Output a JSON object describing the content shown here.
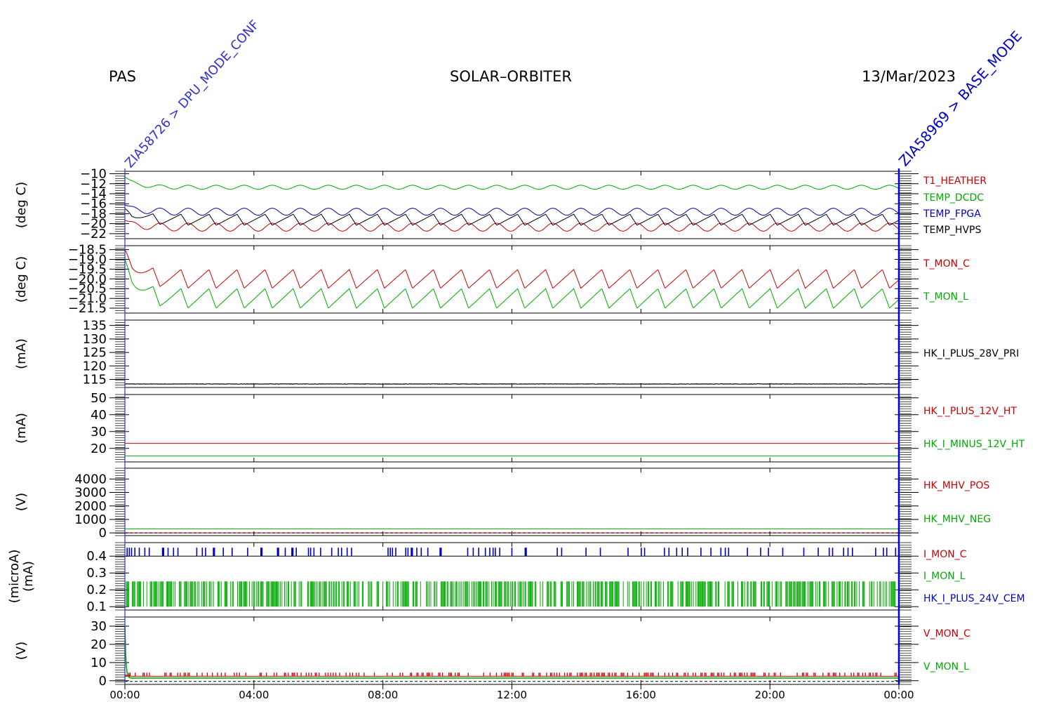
{
  "header": {
    "instrument": "PAS",
    "mission": "SOLAR–ORBITER",
    "date": "13/Mar/2023"
  },
  "event_markers": {
    "left": {
      "label": "ZIA58726 > DPU_MODE_CONF",
      "color": "#3333cc"
    },
    "right": {
      "label": "ZIA58969 > BASE_MODE",
      "color": "#0000cc"
    }
  },
  "chart_data": [
    {
      "type": "line",
      "panel": "temperatures",
      "ylabel": "(deg C)",
      "yticks": [
        -10,
        -12,
        -14,
        -16,
        -18,
        -20,
        -22
      ],
      "ytick_labels": [
        "−10",
        "−12",
        "−14",
        "−16",
        "−18",
        "−20",
        "−22"
      ],
      "ylim": [
        -23,
        -9.5
      ],
      "series": [
        {
          "name": "T1_HEATHER",
          "color": "#cc0000",
          "start": -19.3,
          "mean": -20.7,
          "amplitude": 0.8,
          "wave": "sine",
          "period_hours": 0.87
        },
        {
          "name": "TEMP_DCDC",
          "color": "#00aa00",
          "start": -10.6,
          "mean": -12.7,
          "amplitude": 0.4,
          "wave": "sine",
          "period_hours": 0.87
        },
        {
          "name": "TEMP_FPGA",
          "color": "#0000bb",
          "start": -16.2,
          "mean": -17.6,
          "amplitude": 0.7,
          "wave": "sine",
          "period_hours": 0.87
        },
        {
          "name": "TEMP_HVPS",
          "color": "#000000",
          "start": -17.0,
          "mean": -19.2,
          "amplitude": 1.1,
          "wave": "saw",
          "period_hours": 0.87
        }
      ]
    },
    {
      "type": "line",
      "panel": "monitor_temperatures",
      "ylabel": "(deg C)",
      "yticks": [
        -18.5,
        -19.0,
        -19.5,
        -20.0,
        -20.5,
        -21.0,
        -21.5
      ],
      "ytick_labels": [
        "−18.5",
        "−19.0",
        "−19.5",
        "−20.0",
        "−20.5",
        "−21.0",
        "−21.5"
      ],
      "ylim": [
        -21.75,
        -18.3
      ],
      "series": [
        {
          "name": "T_MON_C",
          "color": "#cc0000",
          "start": -18.5,
          "mean": -20.0,
          "amplitude": 0.48,
          "wave": "saw",
          "period_hours": 0.87
        },
        {
          "name": "T_MON_L",
          "color": "#00aa00",
          "start": -19.0,
          "mean": -21.0,
          "amplitude": 0.5,
          "wave": "saw",
          "period_hours": 0.87
        }
      ]
    },
    {
      "type": "line",
      "panel": "primary_current",
      "ylabel": "(mA)",
      "yticks": [
        115,
        120,
        125,
        130,
        135
      ],
      "ytick_labels": [
        "115",
        "120",
        "125",
        "130",
        "135"
      ],
      "ylim": [
        112,
        137
      ],
      "series": [
        {
          "name": "HK_I_PLUS_28V_PRI",
          "color": "#000000",
          "value": 113.3,
          "wave": "noise",
          "noise": 0.08
        }
      ]
    },
    {
      "type": "line",
      "panel": "heater_currents",
      "ylabel": "(mA)",
      "yticks": [
        20,
        30,
        40,
        50
      ],
      "ytick_labels": [
        "20",
        "30",
        "40",
        "50"
      ],
      "ylim": [
        12,
        52
      ],
      "series": [
        {
          "name": "HK_I_PLUS_12V_HT",
          "color": "#cc0000",
          "value": 23,
          "wave": "flat"
        },
        {
          "name": "HK_I_MINUS_12V_HT",
          "color": "#00aa00",
          "value": 15.5,
          "wave": "flat"
        }
      ]
    },
    {
      "type": "line",
      "panel": "mcp_voltages",
      "ylabel": "(V)",
      "yticks": [
        0,
        1000,
        2000,
        3000,
        4000
      ],
      "ytick_labels": [
        "0",
        "1000",
        "2000",
        "3000",
        "4000"
      ],
      "ylim": [
        -200,
        4800
      ],
      "series": [
        {
          "name": "HK_MHV_POS",
          "color": "#cc0000",
          "value": 0,
          "wave": "flat"
        },
        {
          "name": "HK_MHV_NEG",
          "color": "#00aa00",
          "value": 300,
          "wave": "flat"
        }
      ]
    },
    {
      "type": "line",
      "panel": "cem_currents",
      "ylabel": "(microA) (mA)",
      "ylabel_lines": [
        "(microA)",
        "(mA)"
      ],
      "yticks": [
        0.1,
        0.2,
        0.3,
        0.4
      ],
      "ytick_labels": [
        "0.1",
        "0.2",
        "0.3",
        "0.4"
      ],
      "ylim": [
        0.08,
        0.48
      ],
      "series": [
        {
          "name": "I_MON_C",
          "color": "#cc0000",
          "wave": "none"
        },
        {
          "name": "I_MON_L",
          "color": "#00aa00",
          "low": 0.1,
          "high": 0.25,
          "wave": "bursts",
          "density": 0.55
        },
        {
          "name": "HK_I_PLUS_24V_CEM",
          "color": "#0000cc",
          "low": 0.4,
          "high": 0.45,
          "wave": "spikes",
          "density": 0.12
        }
      ]
    },
    {
      "type": "line",
      "panel": "monitor_voltages",
      "ylabel": "(V)",
      "yticks": [
        0,
        10,
        20,
        30
      ],
      "ytick_labels": [
        "0",
        "10",
        "20",
        "30"
      ],
      "ylim": [
        -2,
        35
      ],
      "series": [
        {
          "name": "V_MON_C",
          "color": "#cc0000",
          "start": 3,
          "value": 2.5,
          "wave": "redspikes"
        },
        {
          "name": "V_MON_L",
          "color": "#00aa00",
          "start": 30,
          "value": 1.5,
          "wave": "decay"
        }
      ]
    }
  ],
  "x_axis": {
    "range_hours": [
      0,
      24
    ],
    "tick_hours": [
      0,
      4,
      8,
      12,
      16,
      20,
      24
    ],
    "tick_labels": [
      "00:00",
      "04:00",
      "08:00",
      "12:00",
      "16:00",
      "20:00",
      "00:00"
    ]
  }
}
